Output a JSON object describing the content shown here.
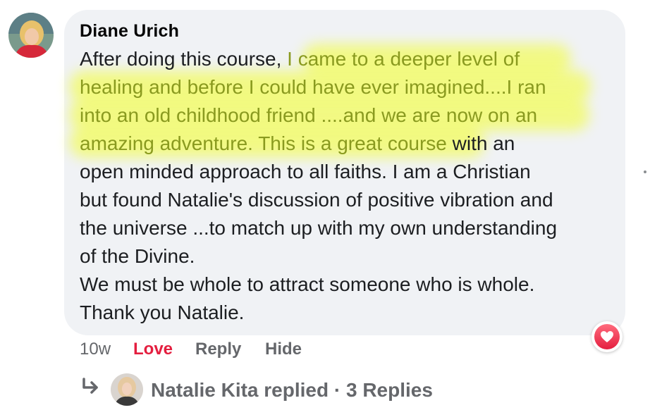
{
  "comment": {
    "author": "Diane Urich",
    "lines": [
      {
        "plain_before": "After doing this course, ",
        "highlight": "I came to a deeper level of",
        "plain_after": ""
      },
      {
        "plain_before": "",
        "highlight": "healing and before I could have ever imagined....I ran",
        "plain_after": ""
      },
      {
        "plain_before": "",
        "highlight": "into an old childhood friend ....and we are now on an",
        "plain_after": ""
      },
      {
        "plain_before": "",
        "highlight": "amazing adventure. This is a great course",
        "plain_after": " with an"
      },
      {
        "plain_before": "open minded approach to all faiths. I am a Christian",
        "highlight": "",
        "plain_after": ""
      },
      {
        "plain_before": "but found Natalie's discussion of positive vibration and",
        "highlight": "",
        "plain_after": ""
      },
      {
        "plain_before": "the universe ...to match up with my own understanding",
        "highlight": "",
        "plain_after": ""
      },
      {
        "plain_before": "of the Divine.",
        "highlight": "",
        "plain_after": ""
      },
      {
        "plain_before": "We must be whole to attract someone who is whole.",
        "highlight": "",
        "plain_after": ""
      },
      {
        "plain_before": "Thank you Natalie.",
        "highlight": "",
        "plain_after": ""
      }
    ]
  },
  "actions": {
    "time": "10w",
    "love": "Love",
    "reply": "Reply",
    "hide": "Hide"
  },
  "reaction": {
    "icon": "heart-icon",
    "color": "#e41e3f"
  },
  "replies": {
    "text": "Natalie Kita replied · 3 Replies",
    "icon": "reply-arrow-icon"
  },
  "colors": {
    "bubble": "#f0f2f5",
    "highlight_text": "#8a9a1f",
    "highlight_marker": "#f3ff2a",
    "secondary_text": "#65676b",
    "love": "#e41e3f"
  }
}
